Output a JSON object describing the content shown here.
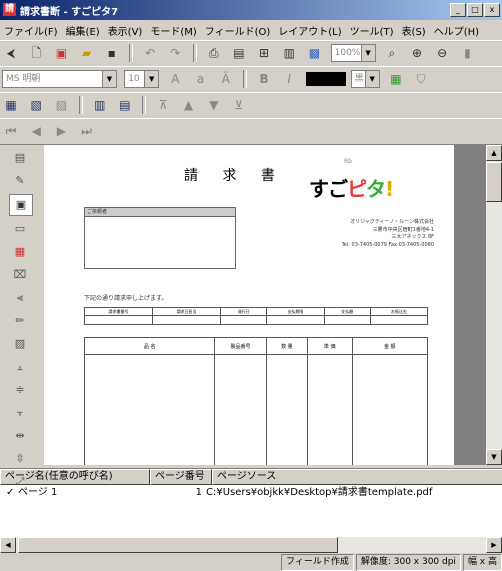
{
  "window": {
    "title": "請求書断 - すごピタ7",
    "icon_label": "請",
    "buttons": {
      "minimize": "_",
      "maximize": "□",
      "close": "x"
    }
  },
  "menu": [
    "ファイル(F)",
    "編集(E)",
    "表示(V)",
    "モード(M)",
    "フィールド(O)",
    "レイアウト(L)",
    "ツール(T)",
    "表(S)",
    "ヘルプ(H)"
  ],
  "toolbar2": {
    "font_name": "MS 明朝",
    "font_size": "10",
    "bold": "B",
    "italic": "I",
    "color_label": "黒"
  },
  "toolbar1": {
    "zoom": "100%"
  },
  "document": {
    "title": "請 求 書",
    "logo_mark": "Rb",
    "logo": {
      "a": "すご",
      "b": "ピ",
      "c": "タ",
      "d": "!"
    },
    "company_lines": [
      "オリジャクティーノ・ルーン株式会社",
      "三鷹市中央区宿町1番地4-1",
      "三大アネックス 8F",
      "Tel: 03-7405-0079  Fax 03-7405-0080"
    ],
    "address_label": "ご依頼者",
    "request_text": "下記の通り請求申し上げます。",
    "info_headers": [
      "請求書番号",
      "請求日担当",
      "発行日",
      "支払期限",
      "支払額",
      "お振込先"
    ],
    "item_headers": [
      "品    名",
      "製品番号",
      "数 量",
      "単 価",
      "金    額"
    ]
  },
  "pane": {
    "headers": [
      "ページ名(任意の呼び名)",
      "ページ番号",
      "ページソース"
    ],
    "rows": [
      {
        "check": "✓",
        "name": "ページ 1",
        "number": "1",
        "source": "C:¥Users¥objkk¥Desktop¥請求書template.pdf"
      }
    ]
  },
  "status": {
    "mode": "フィールド作成",
    "resolution": "解像度: 300 x 300 dpi",
    "fit": "幅 x 高"
  }
}
